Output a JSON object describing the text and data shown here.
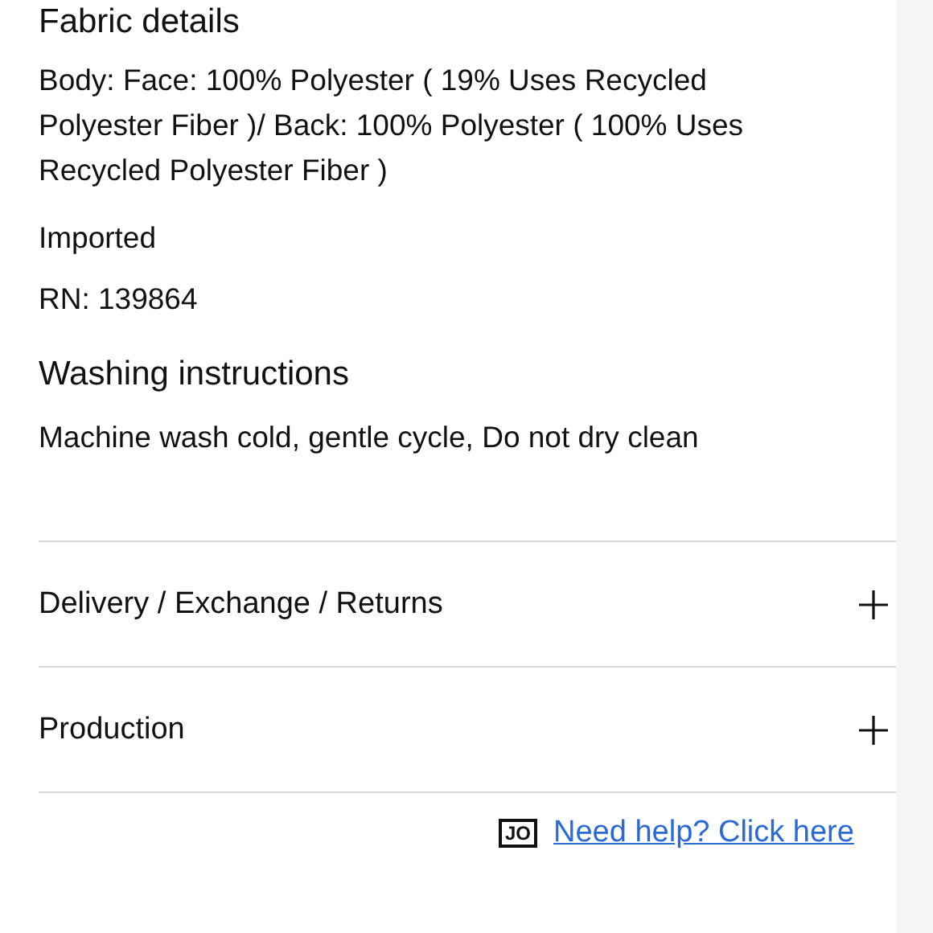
{
  "fabric": {
    "title": "Fabric details",
    "composition": "Body: Face: 100% Polyester ( 19% Uses Recycled Polyester Fiber )/ Back: 100% Polyester ( 100% Uses Recycled Polyester Fiber )",
    "lines": [
      "Imported",
      "RN: 139864"
    ]
  },
  "washing": {
    "title": "Washing instructions",
    "text": "Machine wash cold, gentle cycle, Do not dry clean"
  },
  "sections": [
    {
      "label": "Delivery / Exchange / Returns",
      "expanded": false
    },
    {
      "label": "Production",
      "expanded": false
    }
  ],
  "help": {
    "badge": "JO",
    "link": "Need help? Click here"
  }
}
